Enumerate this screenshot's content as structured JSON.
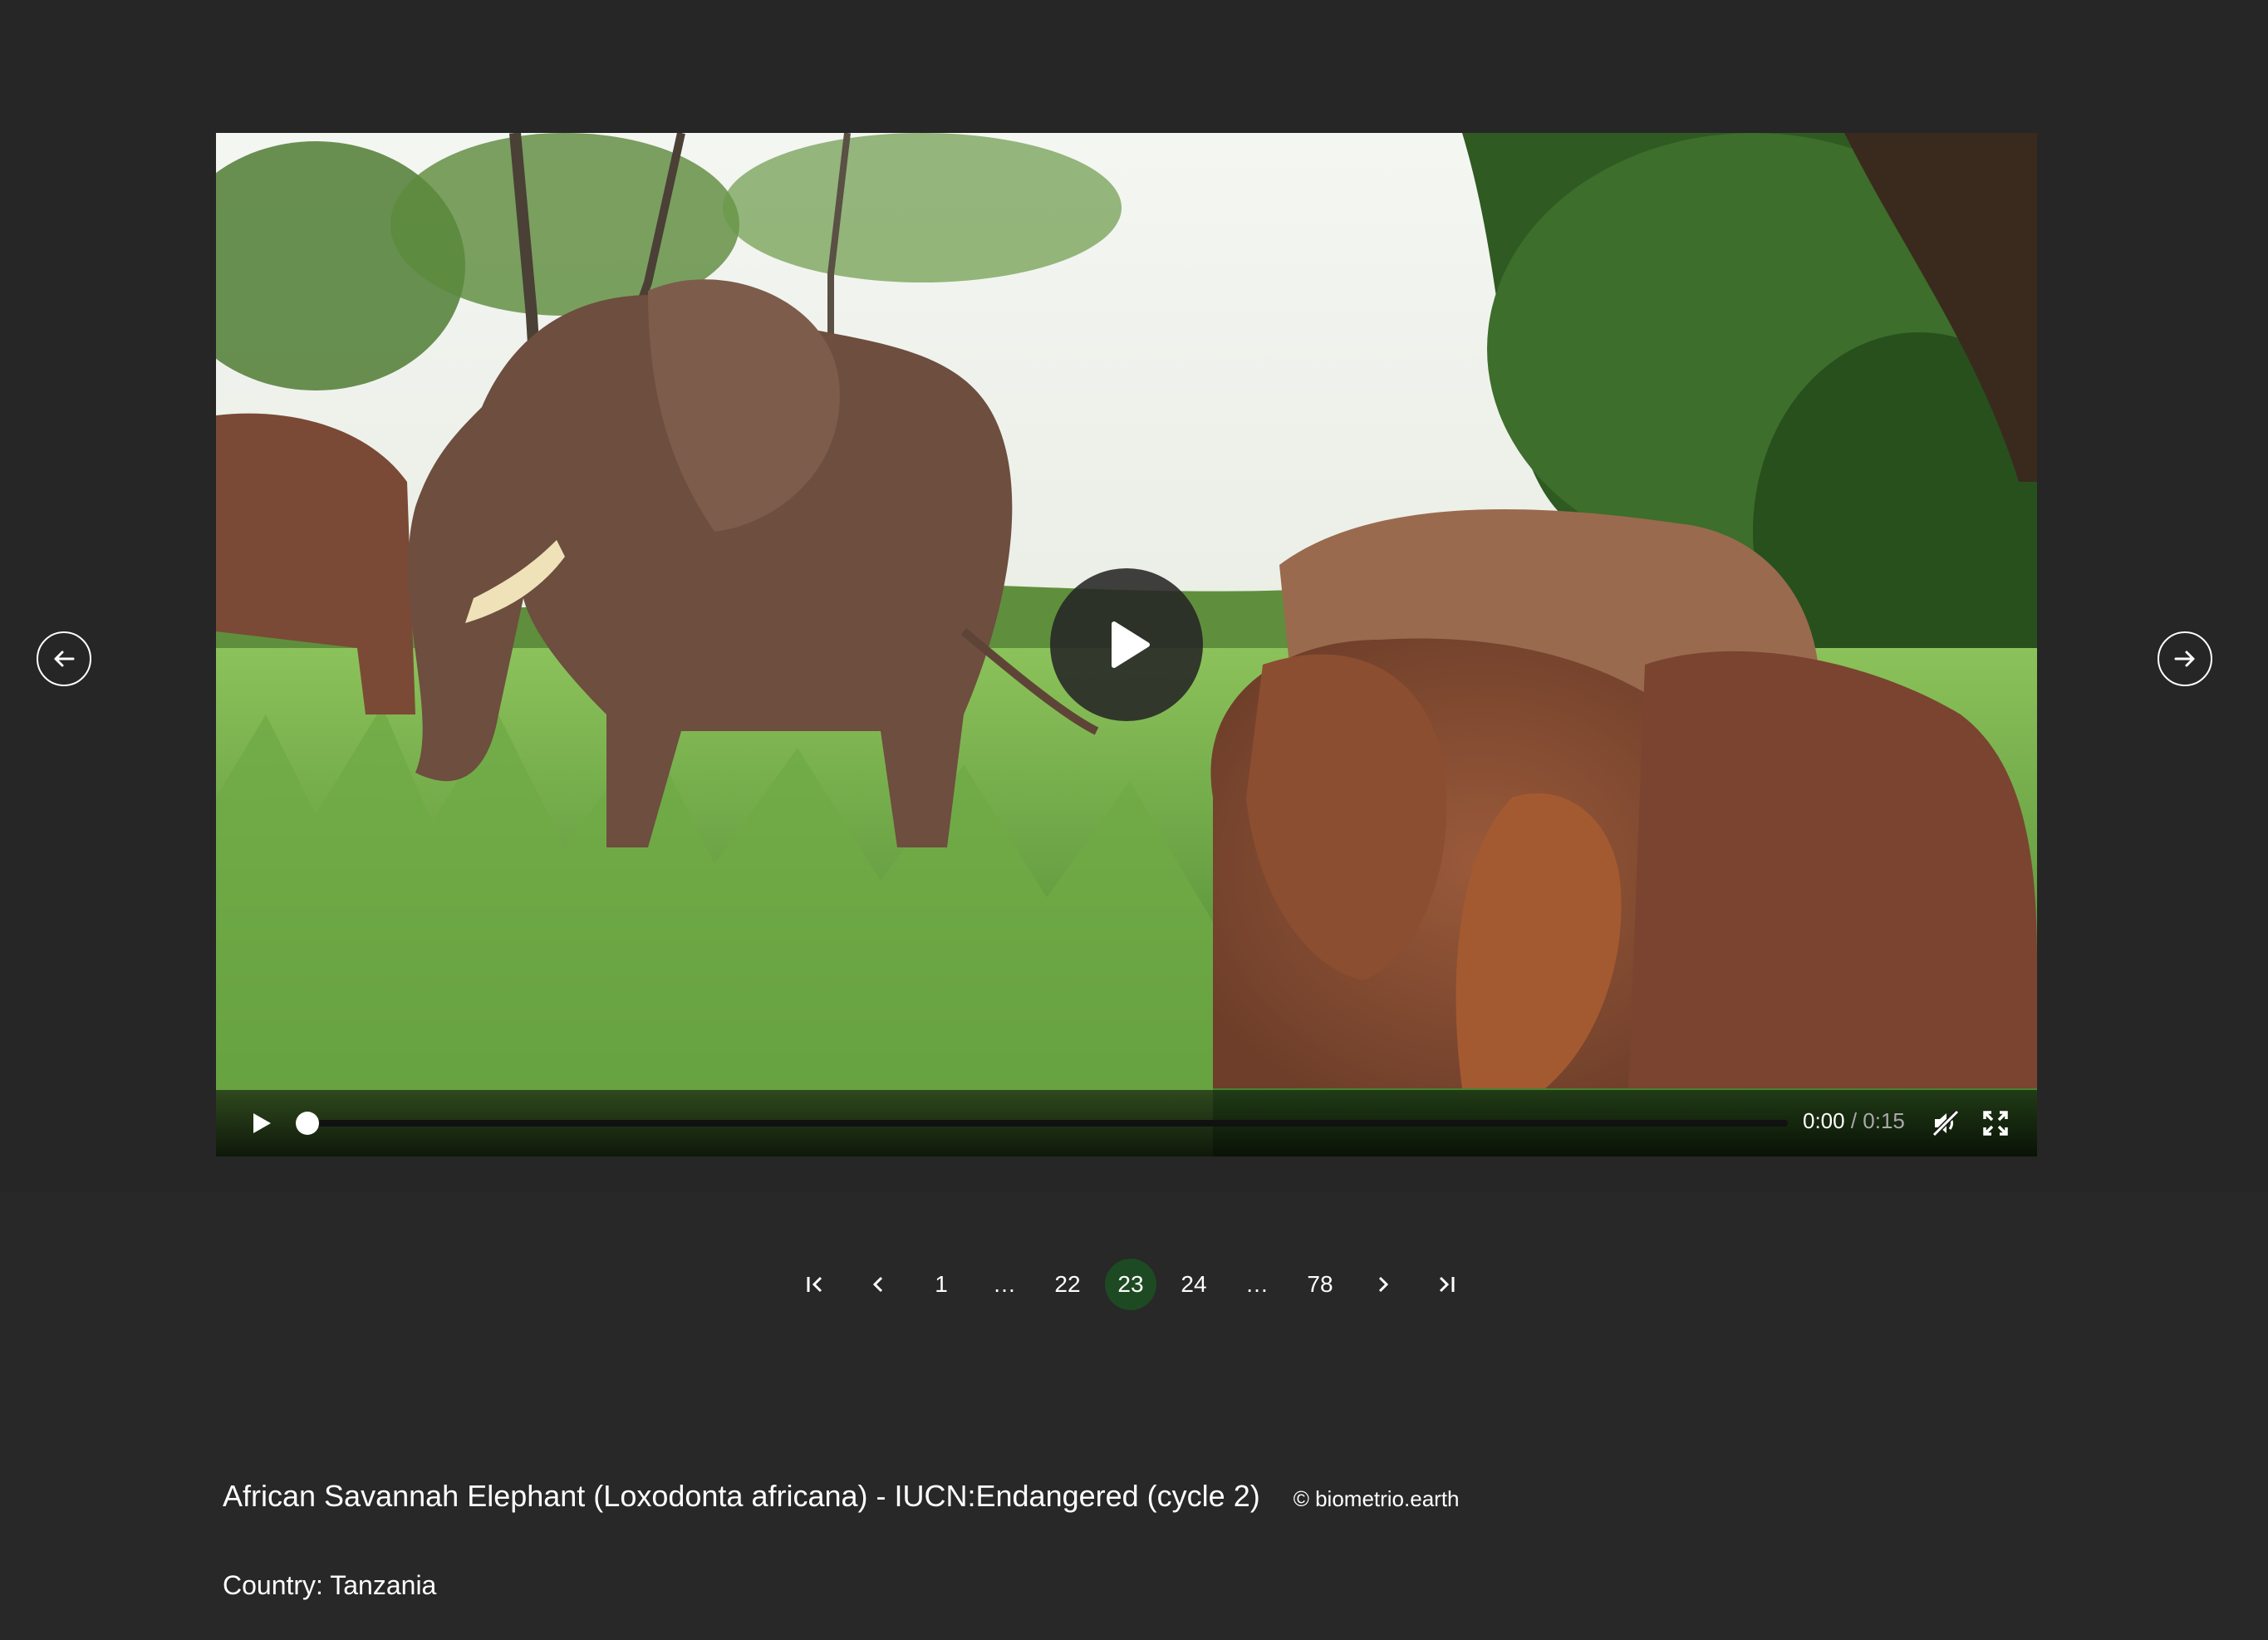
{
  "player": {
    "current_time": "0:00",
    "separator": " / ",
    "duration": "0:15",
    "progress": 0.0,
    "muted": true
  },
  "pagination": {
    "pages": [
      "1",
      "…",
      "22",
      "23",
      "24",
      "…",
      "78"
    ],
    "current": "23",
    "active_color": "#1d4a22"
  },
  "caption": {
    "title": "African Savannah Elephant (Loxodonta africana) - IUCN:Endangered (cycle 2)",
    "credit": "© biometrio.earth",
    "country": "Country: Tanzania"
  },
  "icons": {
    "prev": "arrow-left-icon",
    "next": "arrow-right-icon",
    "play": "play-icon",
    "mute": "volume-muted-icon",
    "fullscreen": "fullscreen-icon",
    "first": "first-page-icon",
    "previous_page": "chevron-left-icon",
    "next_page": "chevron-right-icon",
    "last": "last-page-icon"
  },
  "colors": {
    "background": "#282828",
    "accent": "#1d4a22"
  }
}
